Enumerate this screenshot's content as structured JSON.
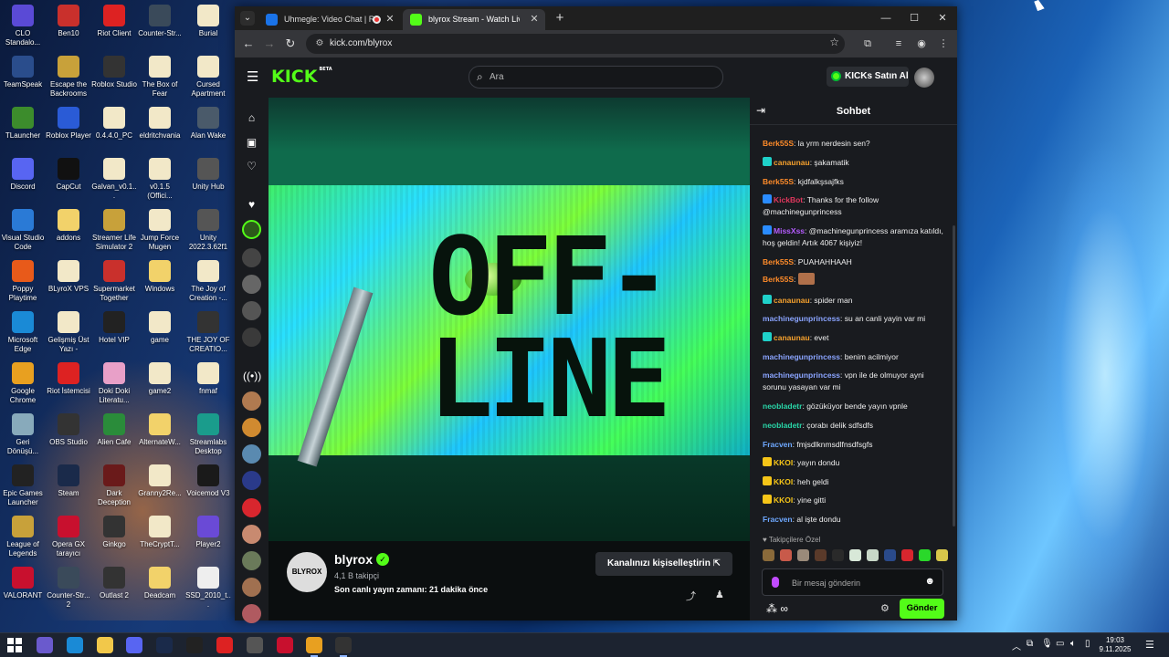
{
  "desktop": {
    "icons": [
      {
        "label": "CLO Standalo...",
        "color": "#5a4ad6"
      },
      {
        "label": "Ben10",
        "color": "#c9302c"
      },
      {
        "label": "Riot Client",
        "color": "#d22"
      },
      {
        "label": "Counter-Str...",
        "color": "#3a4a5a"
      },
      {
        "label": "Burial",
        "color": "#f2e8c8"
      },
      {
        "label": "TeamSpeak",
        "color": "#2a4d8c"
      },
      {
        "label": "Escape the Backrooms",
        "color": "#c8a13a"
      },
      {
        "label": "Roblox Studio",
        "color": "#333"
      },
      {
        "label": "The Box of Fear",
        "color": "#f2e8c8"
      },
      {
        "label": "Cursed Apartment",
        "color": "#f2e8c8"
      },
      {
        "label": "TLauncher",
        "color": "#3c8c2c"
      },
      {
        "label": "Roblox Player",
        "color": "#2a5bd6"
      },
      {
        "label": "0.4.4.0_PC",
        "color": "#f2e8c8"
      },
      {
        "label": "eldritchvania",
        "color": "#f2e8c8"
      },
      {
        "label": "Alan Wake",
        "color": "#4a5a6a"
      },
      {
        "label": "Discord",
        "color": "#5865f2"
      },
      {
        "label": "CapCut",
        "color": "#111"
      },
      {
        "label": "Galvan_v0.1...",
        "color": "#f2e8c8"
      },
      {
        "label": "v0.1.5 (Offici...",
        "color": "#f2e8c8"
      },
      {
        "label": "Unity Hub",
        "color": "#555"
      },
      {
        "label": "Visual Studio Code",
        "color": "#2a7ad6"
      },
      {
        "label": "addons",
        "color": "#f2d26a"
      },
      {
        "label": "Streamer Life Simulator 2",
        "color": "#c8a13a"
      },
      {
        "label": "Jump Force Mugen",
        "color": "#f2e8c8"
      },
      {
        "label": "Unity 2022.3.62f1",
        "color": "#555"
      },
      {
        "label": "Poppy Playtime",
        "color": "#e85a1a"
      },
      {
        "label": "BLyroX VPS",
        "color": "#f2e8c8"
      },
      {
        "label": "Supermarket Together",
        "color": "#c9302c"
      },
      {
        "label": "Windows",
        "color": "#f2d26a"
      },
      {
        "label": "The Joy of Creation -...",
        "color": "#f2e8c8"
      },
      {
        "label": "Microsoft Edge",
        "color": "#1a8ad6"
      },
      {
        "label": "Gelişmiş Üst Yazı -",
        "color": "#f2e8c8"
      },
      {
        "label": "Hotel VIP",
        "color": "#222"
      },
      {
        "label": "game",
        "color": "#f2e8c8"
      },
      {
        "label": "THE JOY OF CREATIO...",
        "color": "#333"
      },
      {
        "label": "Google Chrome",
        "color": "#e8a020"
      },
      {
        "label": "Riot İstemcisi",
        "color": "#d22"
      },
      {
        "label": "Doki Doki Literatu...",
        "color": "#e8a0c8"
      },
      {
        "label": "game2",
        "color": "#f2e8c8"
      },
      {
        "label": "fnmaf",
        "color": "#f2e8c8"
      },
      {
        "label": "Geri Dönüşü...",
        "color": "#8ab"
      },
      {
        "label": "OBS Studio",
        "color": "#333"
      },
      {
        "label": "Alien Cafe",
        "color": "#2a8c3a"
      },
      {
        "label": "AlternateW...",
        "color": "#f2d26a"
      },
      {
        "label": "Streamlabs Desktop",
        "color": "#1a9c8c"
      },
      {
        "label": "Epic Games Launcher",
        "color": "#222"
      },
      {
        "label": "Steam",
        "color": "#1a2a4a"
      },
      {
        "label": "Dark Deception",
        "color": "#6a1a1a"
      },
      {
        "label": "Granny2Re...",
        "color": "#f2e8c8"
      },
      {
        "label": "Voicemod V3",
        "color": "#1a1a1a"
      },
      {
        "label": "League of Legends",
        "color": "#c8a13a"
      },
      {
        "label": "Opera GX tarayıcı",
        "color": "#c8102e"
      },
      {
        "label": "Ginkgo",
        "color": "#333"
      },
      {
        "label": "TheCryptT...",
        "color": "#f2e8c8"
      },
      {
        "label": "Player2",
        "color": "#6a4ad6"
      },
      {
        "label": "VALORANT",
        "color": "#c8102e"
      },
      {
        "label": "Counter-Str... 2",
        "color": "#3a4a5a"
      },
      {
        "label": "Outlast 2",
        "color": "#333"
      },
      {
        "label": "Deadcam",
        "color": "#f2d26a"
      },
      {
        "label": "SSD_2010_t...",
        "color": "#eee"
      }
    ]
  },
  "browser": {
    "tabs": [
      {
        "title": "Uhmegle: Video Chat | Rand",
        "favicon_color": "#1a73e8",
        "recording": true
      },
      {
        "title": "blyrox Stream - Watch Live on K",
        "favicon_color": "#53fc18",
        "active": true
      }
    ],
    "url": "kick.com/blyrox"
  },
  "kick": {
    "logo": "KICK",
    "logo_sup": "BETA",
    "search_placeholder": "Ara",
    "kicks_button": "KICKs Satın Al",
    "offline_line1": "OFF-",
    "offline_line2": "LINE",
    "channel": {
      "avatar_text": "BLYROX",
      "name": "blyrox",
      "followers": "4,1 B takipçi",
      "last_stream": "Son canlı yayın zamanı: 21 dakika önce",
      "customize_button": "Kanalınızı kişiselleştirin"
    },
    "chat": {
      "title": "Sohbet",
      "messages": [
        {
          "user": "Berk55S",
          "color": "#ff8c2a",
          "badge": "",
          "text": "la yrm nerdesin sen?"
        },
        {
          "user": "canaunau",
          "color": "#f6a12d",
          "badge": "#1fd1c9",
          "text": "şakamatik"
        },
        {
          "user": "Berk55S",
          "color": "#ff8c2a",
          "badge": "",
          "text": "kjdfalkşsajfks"
        },
        {
          "user": "KickBot",
          "color": "#e0375d",
          "badge": "#2a8cff",
          "text": "Thanks for the follow @machinegunprincess"
        },
        {
          "user": "MissXss",
          "color": "#b55cff",
          "badge": "#2a8cff",
          "text": "@machinegunprincess aramıza katıldı, hoş geldin! Artık 4067 kişiyiz!"
        },
        {
          "user": "Berk55S",
          "color": "#ff8c2a",
          "badge": "",
          "text": "PUAHAHHAAH"
        },
        {
          "user": "Berk55S",
          "color": "#ff8c2a",
          "badge": "",
          "text": ""
        },
        {
          "user": "canaunau",
          "color": "#f6a12d",
          "badge": "#1fd1c9",
          "text": "spider man"
        },
        {
          "user": "machinegunprincess",
          "color": "#8aa4ff",
          "badge": "",
          "text": "su an canli yayin var mi"
        },
        {
          "user": "canaunau",
          "color": "#f6a12d",
          "badge": "#1fd1c9",
          "text": "evet"
        },
        {
          "user": "machinegunprincess",
          "color": "#8aa4ff",
          "badge": "",
          "text": "benim acilmiyor"
        },
        {
          "user": "machinegunprincess",
          "color": "#8aa4ff",
          "badge": "",
          "text": "vpn ile de olmuyor ayni sorunu yasayan var mi"
        },
        {
          "user": "neobladetr",
          "color": "#29d6a8",
          "badge": "",
          "text": "gözüküyor bende yayın vpnle"
        },
        {
          "user": "neobladetr",
          "color": "#29d6a8",
          "badge": "",
          "text": "çorabı delik sdfsdfs"
        },
        {
          "user": "Fracven",
          "color": "#6ea8ff",
          "badge": "",
          "text": "fmjsdlknmsdlfnsdfsgfs"
        },
        {
          "user": "KKOI",
          "color": "#f5c518",
          "badge": "#f5c518",
          "text": "yayın dondu"
        },
        {
          "user": "KKOI",
          "color": "#f5c518",
          "badge": "#f5c518",
          "text": "heh geldi"
        },
        {
          "user": "KKOI",
          "color": "#f5c518",
          "badge": "#f5c518",
          "text": "yine gitti"
        },
        {
          "user": "Fracven",
          "color": "#6ea8ff",
          "badge": "",
          "text": "al işte dondu"
        }
      ],
      "followers_only": "Takipçilere Özel",
      "input_placeholder": "Bir mesaj gönderin",
      "send_button": "Gönder"
    }
  },
  "taskbar": {
    "time": "19:03",
    "date": "9.11.2025"
  }
}
